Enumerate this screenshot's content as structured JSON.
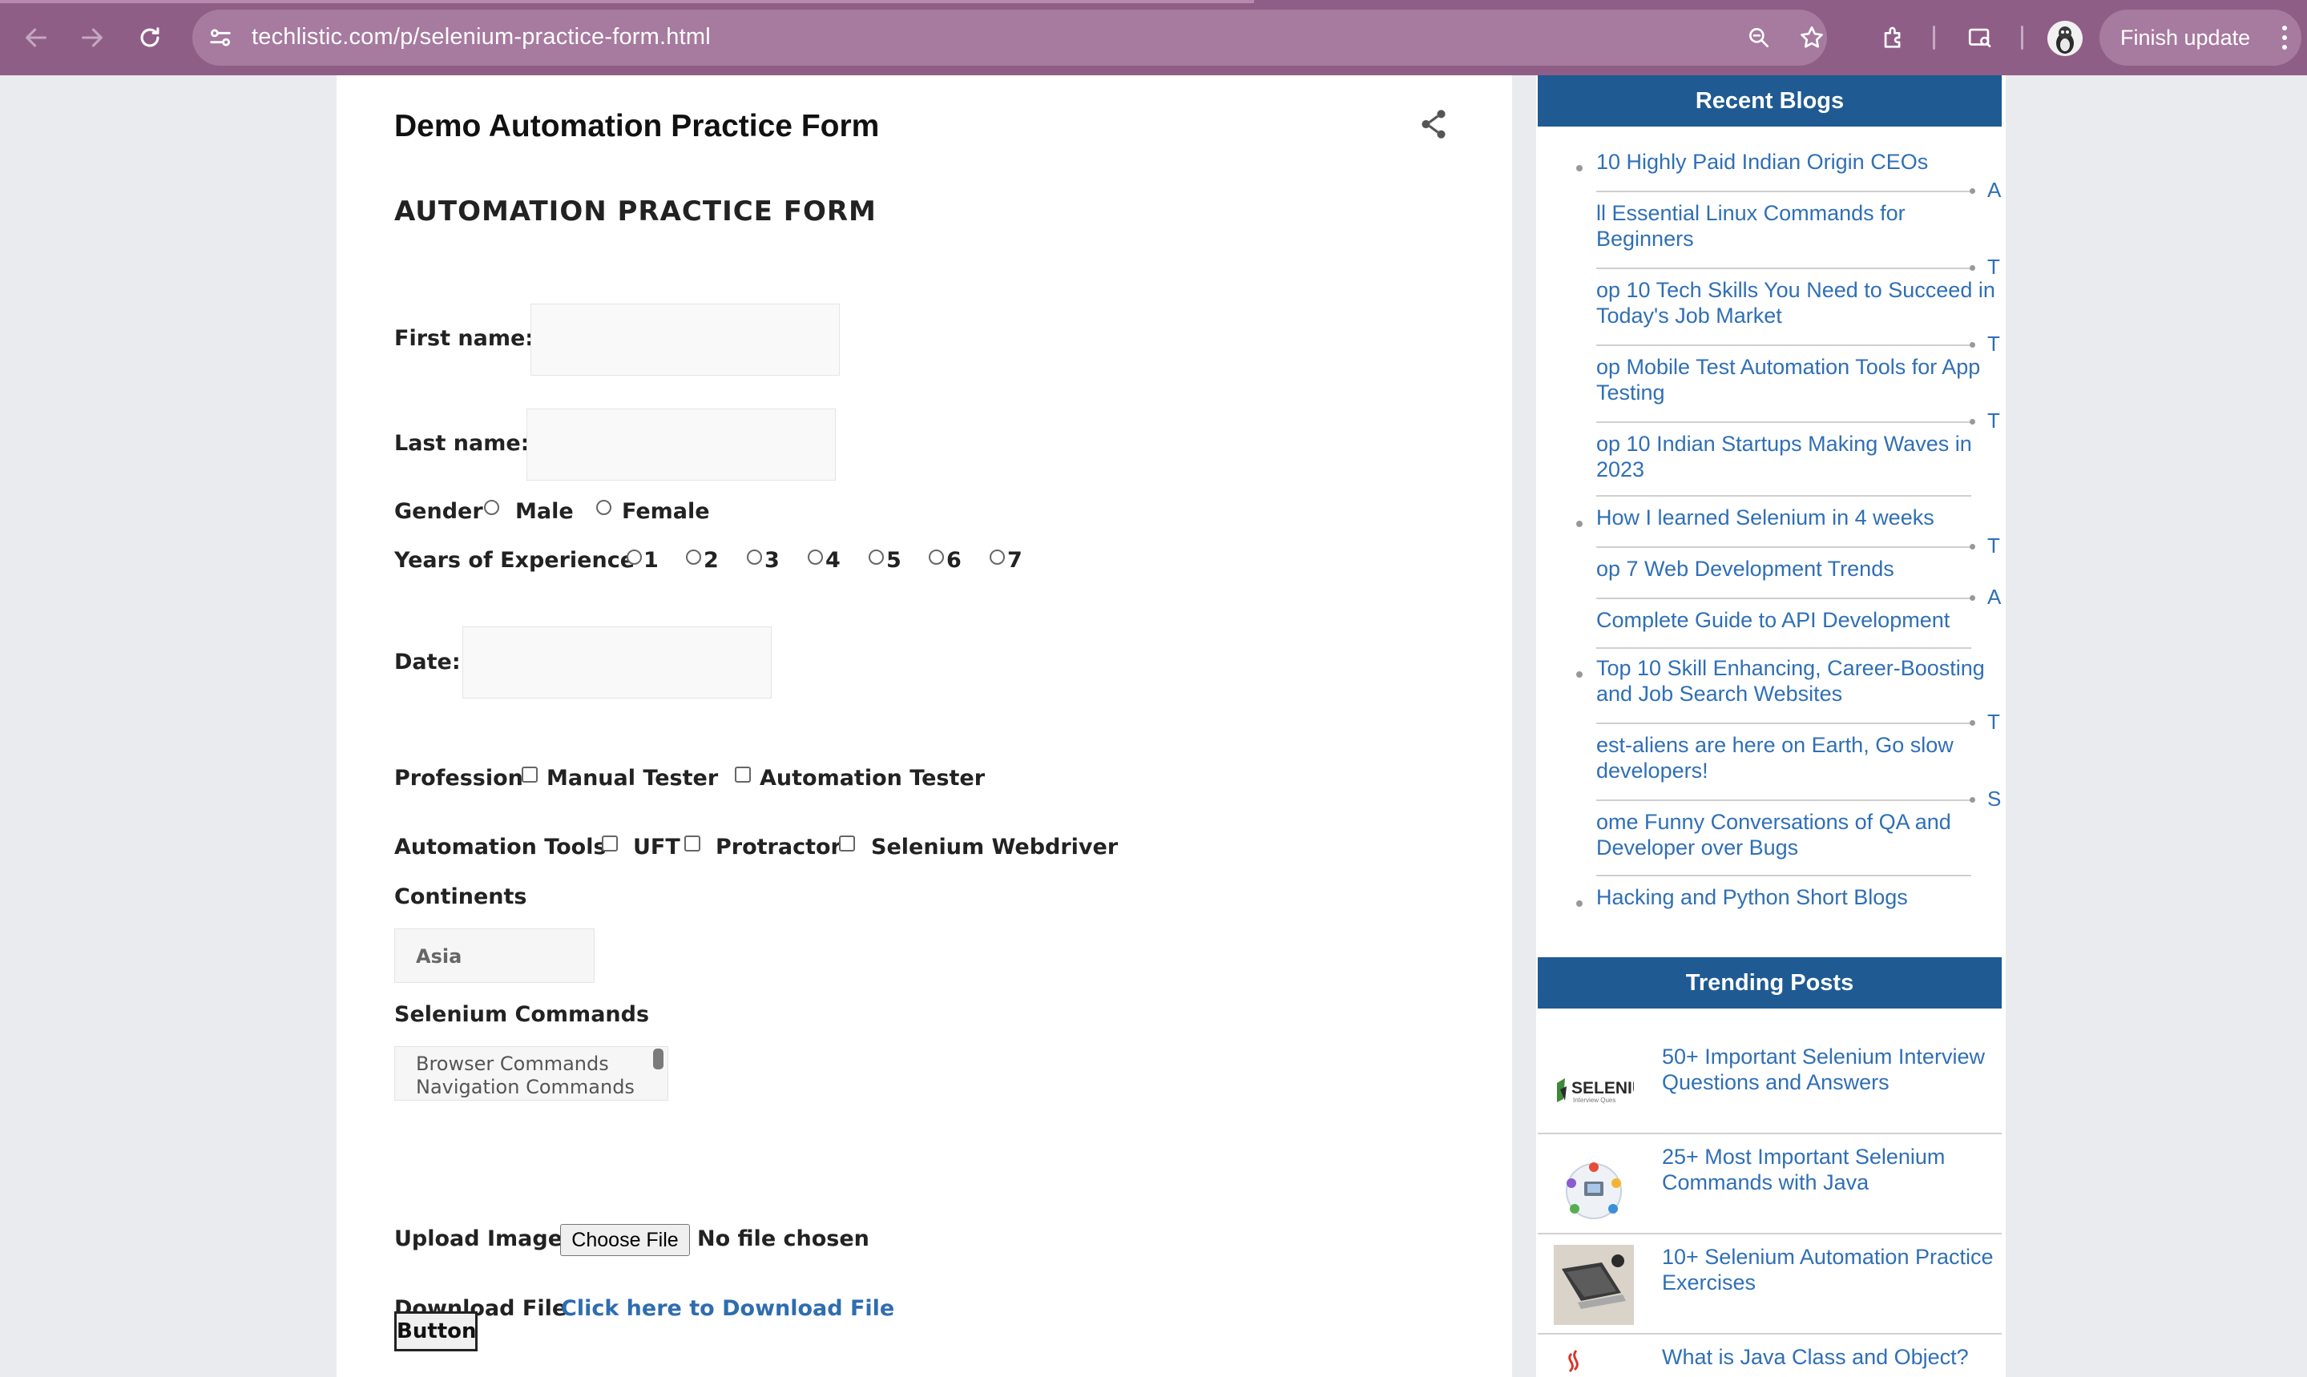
{
  "browser": {
    "url": "techlistic.com/p/selenium-practice-form.html",
    "finish_update": "Finish update",
    "colors": {
      "frame": "#8f5e87",
      "omnibox": "#a77a9f"
    }
  },
  "page": {
    "title": "Demo Automation Practice Form",
    "form_heading": "AUTOMATION PRACTICE FORM",
    "first_name_label": "First name:",
    "last_name_label": "Last name:",
    "gender_label": "Gender",
    "gender_options": [
      "Male",
      "Female"
    ],
    "experience_label": "Years of Experience",
    "experience_options": [
      "1",
      "2",
      "3",
      "4",
      "5",
      "6",
      "7"
    ],
    "date_label": "Date:",
    "profession_label": "Profession",
    "profession_options": [
      "Manual Tester",
      "Automation Tester"
    ],
    "tools_label": "Automation Tools",
    "tools_options": [
      "UFT",
      "Protractor",
      "Selenium Webdriver"
    ],
    "continents_label": "Continents",
    "continents_selected": "Asia",
    "commands_label": "Selenium Commands",
    "commands_options": [
      "Browser Commands",
      "Navigation Commands"
    ],
    "upload_label": "Upload Image",
    "choose_file": "Choose File",
    "no_file": "No file chosen",
    "download_label": "Download File",
    "download_link": "Click here to Download File",
    "button": "Button",
    "link_color": "#2e6db0"
  },
  "sidebar": {
    "recent_heading": "Recent Blogs",
    "recent": [
      "10 Highly Paid Indian Origin CEOs",
      "ll Essential Linux Commands for Beginners",
      "op 10 Tech Skills You Need to Succeed in Today's Job Market",
      "op Mobile Test Automation Tools for App Testing",
      "op 10 Indian Startups Making Waves in 2023",
      "How I learned Selenium in 4 weeks",
      "op 7 Web Development Trends",
      "Complete Guide to API Development",
      "Top 10 Skill Enhancing, Career-Boosting and Job Search Websites",
      "est-aliens are here on Earth, Go slow developers!",
      "ome Funny Conversations of QA and Developer over Bugs",
      "Hacking and Python Short Blogs"
    ],
    "letters": [
      "A",
      "T",
      "T",
      "T",
      "T",
      "A",
      "T",
      "S"
    ],
    "trending_heading": "Trending Posts",
    "trending": [
      "50+ Important Selenium Interview Questions and Answers",
      "25+ Most Important Selenium Commands with Java",
      "10+ Selenium Automation Practice Exercises",
      "What is Java Class and Object?"
    ],
    "thumb_text": "SELENIU",
    "thumb_sub": "Interview Ques",
    "header_color": "#1f5a93"
  }
}
